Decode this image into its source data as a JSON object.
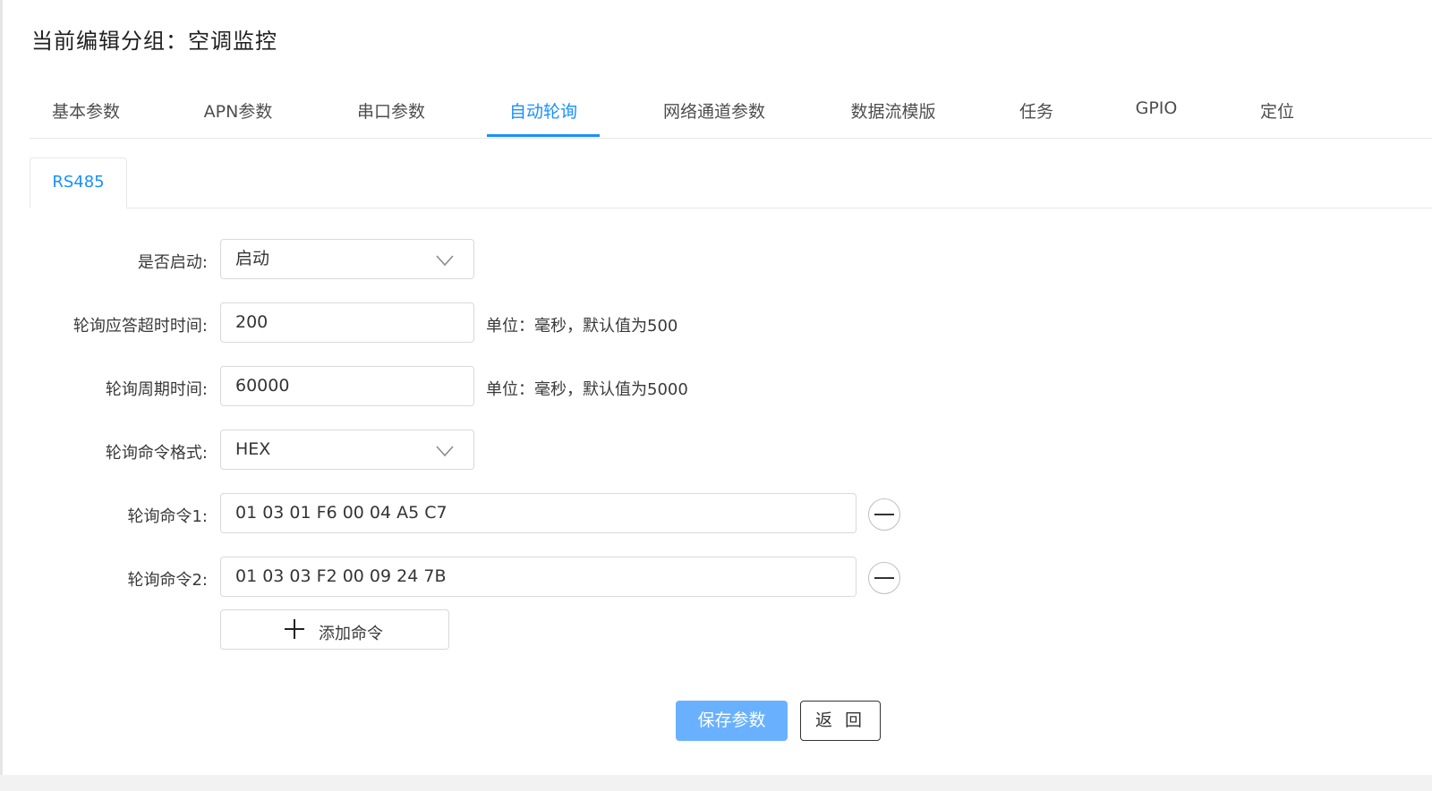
{
  "header": {
    "title": "当前编辑分组：空调监控"
  },
  "tabs": [
    {
      "label": "基本参数"
    },
    {
      "label": "APN参数"
    },
    {
      "label": "串口参数"
    },
    {
      "label": "自动轮询",
      "active": true
    },
    {
      "label": "网络通道参数"
    },
    {
      "label": "数据流模版"
    },
    {
      "label": "任务"
    },
    {
      "label": "GPIO"
    },
    {
      "label": "定位"
    }
  ],
  "subtabs": [
    {
      "label": "RS485",
      "active": true
    }
  ],
  "form": {
    "enable": {
      "label": "是否启动:",
      "value": "启动"
    },
    "timeout": {
      "label": "轮询应答超时时间:",
      "value": "200",
      "hint": "单位：毫秒，默认值为500"
    },
    "period": {
      "label": "轮询周期时间:",
      "value": "60000",
      "hint": "单位：毫秒，默认值为5000"
    },
    "format": {
      "label": "轮询命令格式:",
      "value": "HEX"
    },
    "commands": [
      {
        "label": "轮询命令1:",
        "value": "01 03 01 F6 00 04 A5 C7"
      },
      {
        "label": "轮询命令2:",
        "value": "01 03 03 F2 00 09 24 7B"
      }
    ],
    "add_command_label": "添加命令"
  },
  "actions": {
    "save_label": "保存参数",
    "back_label": "返 回"
  },
  "icons": {
    "chevron": "chevron-down-icon",
    "remove": "minus-circle-icon",
    "add": "plus-icon"
  },
  "colors": {
    "primary": "#1890ff",
    "primary_button": "#69b1ff"
  }
}
